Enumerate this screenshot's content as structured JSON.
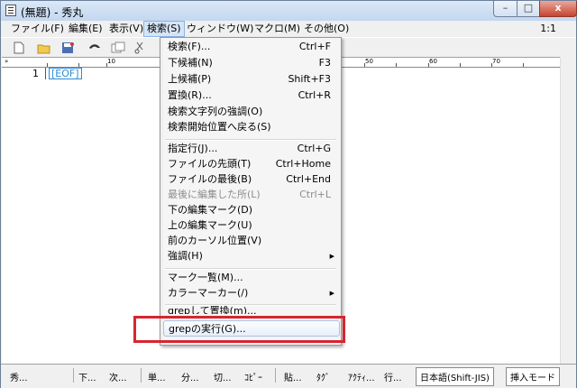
{
  "window": {
    "title": "(無題) - 秀丸",
    "controls": {
      "minimize": "–",
      "maximize": "□",
      "close": "x"
    }
  },
  "menubar": {
    "items": [
      {
        "label": "ファイル(F)"
      },
      {
        "label": "編集(E)"
      },
      {
        "label": "表示(V)"
      },
      {
        "label": "検索(S)",
        "active": true
      },
      {
        "label": "ウィンドウ(W)"
      },
      {
        "label": "マクロ(M)"
      },
      {
        "label": "その他(O)"
      }
    ],
    "position_indicator": "1:1"
  },
  "editor": {
    "line_number": "1",
    "eof_marker": "[EOF]",
    "ruler_labels": [
      "10",
      "50",
      "60",
      "70"
    ]
  },
  "search_menu": {
    "items": [
      {
        "label": "検索(F)...",
        "shortcut": "Ctrl+F"
      },
      {
        "label": "下候補(N)",
        "shortcut": "F3"
      },
      {
        "label": "上候補(P)",
        "shortcut": "Shift+F3"
      },
      {
        "label": "置換(R)...",
        "shortcut": "Ctrl+R"
      },
      {
        "label": "検索文字列の強調(O)",
        "shortcut": ""
      },
      {
        "label": "検索開始位置へ戻る(S)",
        "shortcut": ""
      },
      {
        "label": "指定行(J)...",
        "shortcut": "Ctrl+G"
      },
      {
        "label": "ファイルの先頭(T)",
        "shortcut": "Ctrl+Home"
      },
      {
        "label": "ファイルの最後(B)",
        "shortcut": "Ctrl+End"
      },
      {
        "label": "最後に編集した所(L)",
        "shortcut": "Ctrl+L",
        "disabled": true
      },
      {
        "label": "下の編集マーク(D)",
        "shortcut": ""
      },
      {
        "label": "上の編集マーク(U)",
        "shortcut": ""
      },
      {
        "label": "前のカーソル位置(V)",
        "shortcut": ""
      },
      {
        "label": "強調(H)",
        "shortcut": "",
        "submenu": true
      },
      {
        "label": "マーク一覧(M)...",
        "shortcut": ""
      },
      {
        "label": "カラーマーカー(/)",
        "shortcut": "",
        "submenu": true
      },
      {
        "label": "grepして置換(m)...",
        "shortcut": ""
      },
      {
        "label": "grepの実行(G)...",
        "shortcut": "",
        "highlighted": true
      }
    ]
  },
  "statusbar": {
    "items": [
      "秀...",
      "下...",
      "次...",
      "単...",
      "分...",
      "切...",
      "ｺﾋﾟｰ",
      "貼...",
      "ﾀｸﾞ",
      "ｱｸﾃｨ...",
      "行..."
    ],
    "encoding": "日本語(Shift-JIS)",
    "mode": "挿入モード"
  },
  "colors": {
    "highlight_box": "#d7262e",
    "eof_color": "#2d8bd6"
  }
}
